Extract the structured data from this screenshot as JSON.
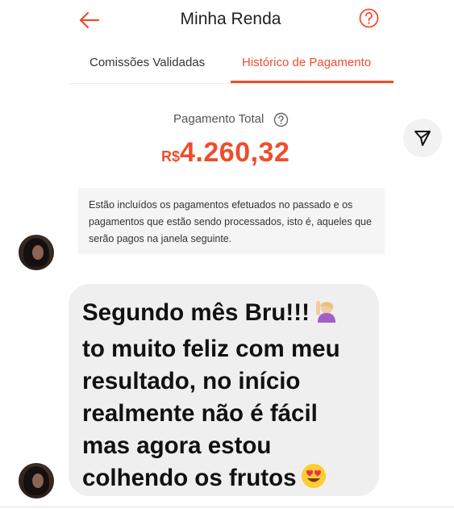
{
  "header": {
    "title": "Minha Renda",
    "back_icon": "arrow-left-icon",
    "help_icon": "question-circle-icon"
  },
  "tabs": [
    {
      "label": "Comissões Validadas",
      "active": false
    },
    {
      "label": "Histórico de Pagamento",
      "active": true
    }
  ],
  "summary": {
    "total_label": "Pagamento Total",
    "currency": "R$",
    "amount": "4.260,32",
    "info": "Estão incluídos os pagamentos efetuados no passado e os pagamentos que estão sendo processados, isto é, aqueles que serão pagos na janela seguinte."
  },
  "share": {
    "icon": "send-icon"
  },
  "message": {
    "lines": [
      "Segundo mês Bru!!!",
      "to muito feliz com meu",
      "resultado, no início",
      "realmente não é fácil",
      "mas agora estou",
      "colhendo os frutos"
    ],
    "emojis": [
      "raising-hand-emoji",
      "heart-eyes-emoji"
    ]
  },
  "colors": {
    "accent": "#ee4d2d",
    "bubble": "#efefef",
    "info_bg": "#f5f5f5"
  }
}
